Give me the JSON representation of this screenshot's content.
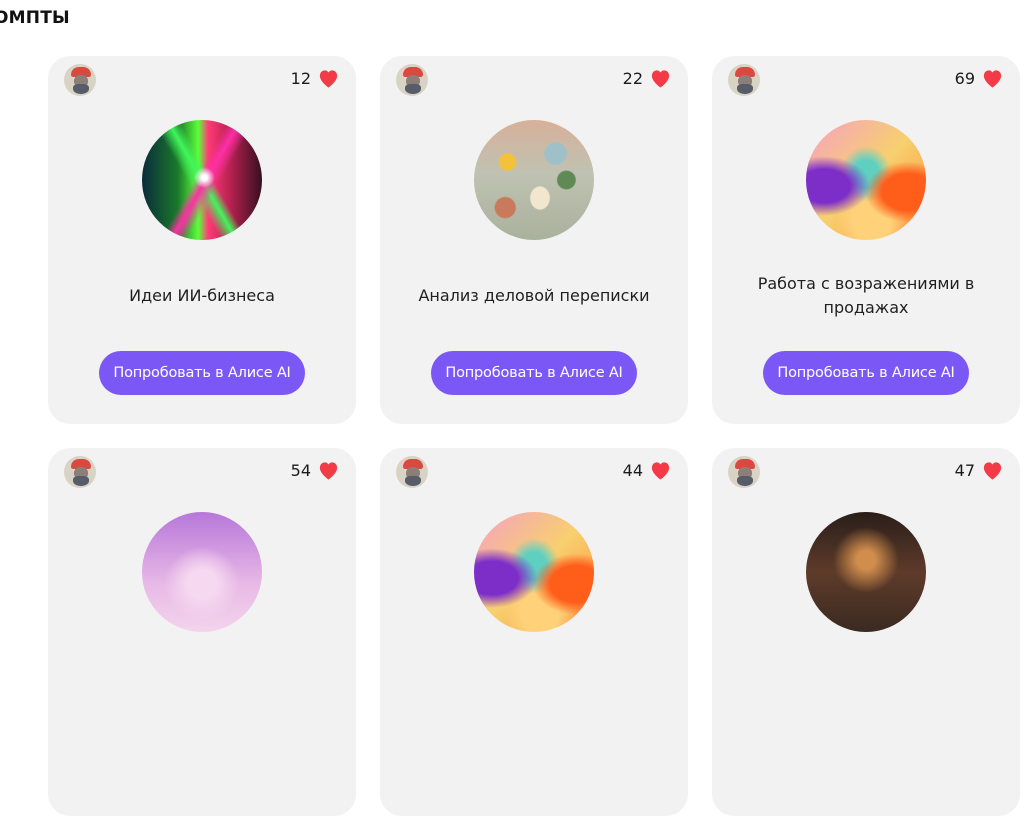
{
  "section": {
    "title": "ОМПТЫ"
  },
  "cards": [
    {
      "likes": "12",
      "title": "Идеи ИИ-бизнеса",
      "button": "Попробовать в Алисе AI",
      "image": "lightning-art"
    },
    {
      "likes": "22",
      "title": "Анализ деловой переписки",
      "button": "Попробовать в Алисе AI",
      "image": "felt-path-art"
    },
    {
      "likes": "69",
      "title": "Работа с возражениями в продажах",
      "button": "Попробовать в Алисе AI",
      "image": "fluid-gradient-art"
    },
    {
      "likes": "54",
      "title": "",
      "button": "",
      "image": "pink-sphere-art"
    },
    {
      "likes": "44",
      "title": "",
      "button": "",
      "image": "fluid-gradient-art"
    },
    {
      "likes": "47",
      "title": "",
      "button": "",
      "image": "dark-abstract-art"
    }
  ],
  "colors": {
    "accent": "#7b58f6",
    "heart": "#f23b46",
    "card": "#f2f2f2"
  },
  "icons": {
    "likes": "heart-icon",
    "author": "avatar-icon"
  }
}
